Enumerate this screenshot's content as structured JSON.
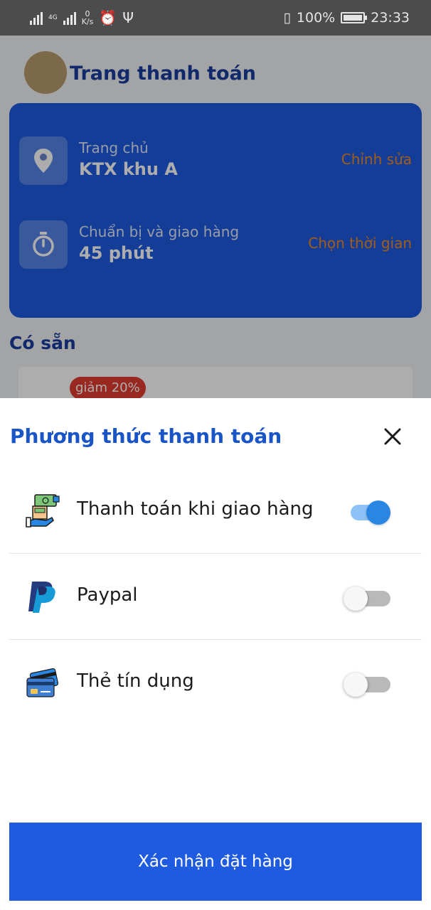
{
  "status_bar": {
    "network_type": "4G",
    "speed_value": "0",
    "speed_unit": "K/s",
    "battery": "100%",
    "time": "23:33"
  },
  "background_page": {
    "title": "Trang thanh toán",
    "address": {
      "label": "Trang chủ",
      "value": "KTX khu A",
      "action": "Chỉnh sửa"
    },
    "time": {
      "label": "Chuẩn bị và giao hàng",
      "value": "45 phút",
      "action": "Chọn thời gian"
    },
    "section_title": "Có sẵn",
    "product": {
      "discount": "giảm 20%"
    }
  },
  "sheet": {
    "title": "Phương thức thanh toán",
    "options": [
      {
        "label": "Thanh toán khi giao hàng",
        "icon": "cash-on-delivery-icon",
        "enabled": true
      },
      {
        "label": "Paypal",
        "icon": "paypal-icon",
        "enabled": false
      },
      {
        "label": "Thẻ tín dụng",
        "icon": "credit-card-icon",
        "enabled": false
      }
    ],
    "confirm_label": "Xác nhận đặt hàng"
  },
  "colors": {
    "primary": "#1e5be0",
    "title_blue": "#1a55c8",
    "accent_orange": "#f28a1c",
    "toggle_on": "#2a86e3"
  }
}
